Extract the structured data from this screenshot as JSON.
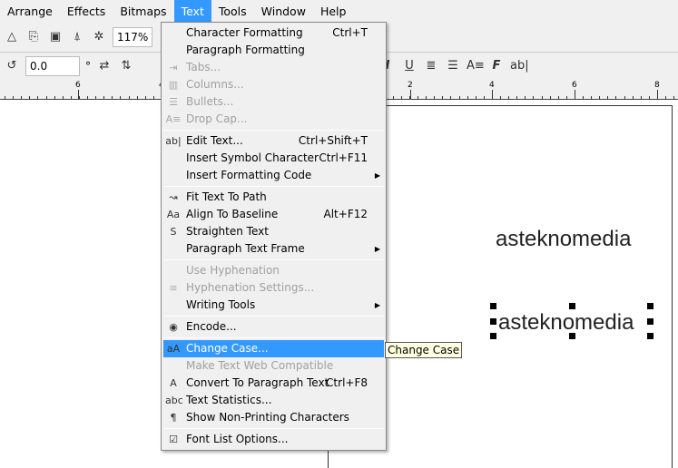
{
  "menubar": [
    {
      "label": "Arrange"
    },
    {
      "label": "Effects"
    },
    {
      "label": "Bitmaps"
    },
    {
      "label": "Text",
      "active": true
    },
    {
      "label": "Tools"
    },
    {
      "label": "Window"
    },
    {
      "label": "Help"
    }
  ],
  "toolbar": {
    "zoom": "117%",
    "rotation": "0.0",
    "degree": "°"
  },
  "ruler": [
    "6",
    "4",
    "2",
    "4",
    "6",
    "8"
  ],
  "canvas": {
    "text1": "asteknomedia",
    "text2": "asteknomedia"
  },
  "menu": {
    "groups": [
      [
        {
          "label": "Character Formatting",
          "shortcut": "Ctrl+T",
          "icon": ""
        },
        {
          "label": "Paragraph Formatting",
          "icon": ""
        },
        {
          "label": "Tabs...",
          "disabled": true,
          "icon": "tabs-icon"
        },
        {
          "label": "Columns...",
          "disabled": true,
          "icon": "columns-icon"
        },
        {
          "label": "Bullets...",
          "disabled": true,
          "icon": "bullets-icon"
        },
        {
          "label": "Drop Cap...",
          "disabled": true,
          "icon": "drop-cap-icon"
        }
      ],
      [
        {
          "label": "Edit Text...",
          "shortcut": "Ctrl+Shift+T",
          "icon": "edit-text-icon"
        },
        {
          "label": "Insert Symbol Character",
          "shortcut": "Ctrl+F11",
          "icon": ""
        },
        {
          "label": "Insert Formatting Code",
          "submenu": true,
          "icon": ""
        }
      ],
      [
        {
          "label": "Fit Text To Path",
          "icon": "fit-text-path-icon"
        },
        {
          "label": "Align To Baseline",
          "shortcut": "Alt+F12",
          "icon": "align-baseline-icon"
        },
        {
          "label": "Straighten Text",
          "icon": "straighten-text-icon"
        },
        {
          "label": "Paragraph Text Frame",
          "submenu": true,
          "icon": ""
        }
      ],
      [
        {
          "label": "Use Hyphenation",
          "disabled": true,
          "icon": ""
        },
        {
          "label": "Hyphenation Settings...",
          "disabled": true,
          "icon": "hyphenation-icon"
        },
        {
          "label": "Writing Tools",
          "submenu": true,
          "icon": ""
        }
      ],
      [
        {
          "label": "Encode...",
          "icon": "encode-icon"
        }
      ],
      [
        {
          "label": "Change Case...",
          "highlighted": true,
          "icon": "change-case-icon"
        },
        {
          "label": "Make Text Web Compatible",
          "disabled": true,
          "icon": ""
        },
        {
          "label": "Convert To Paragraph Text",
          "shortcut": "Ctrl+F8",
          "icon": "convert-text-icon"
        },
        {
          "label": "Text Statistics...",
          "icon": "text-statistics-icon"
        },
        {
          "label": "Show Non-Printing Characters",
          "icon": "pilcrow-icon"
        }
      ],
      [
        {
          "label": "Font List Options...",
          "icon": "font-list-icon"
        }
      ]
    ]
  },
  "tooltip": "Change Case",
  "colors": {
    "highlight": "#3399ff",
    "menu_bg": "#f0f0f0",
    "tooltip_bg": "#ffffe1"
  }
}
